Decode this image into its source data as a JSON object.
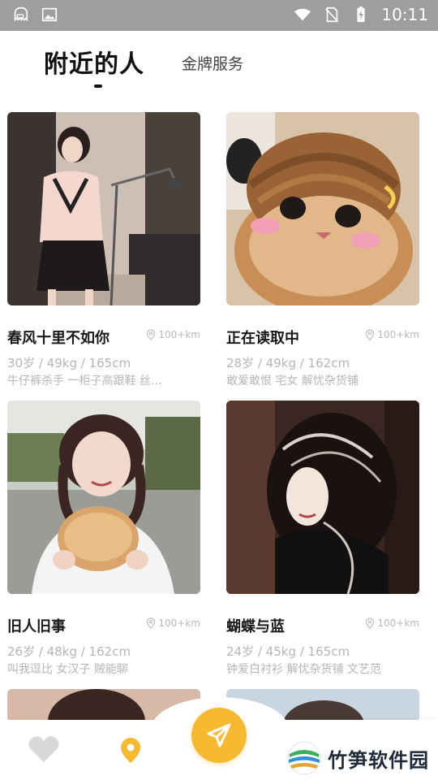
{
  "statusbar": {
    "time": "10:11"
  },
  "tabs": {
    "active": "附近的人",
    "other": "金牌服务"
  },
  "colors": {
    "accent": "#f7b92f",
    "muted_text": "#b5b5b5",
    "status_bar": "#9e9e9e"
  },
  "cards": [
    {
      "name": "春风十里不如你",
      "distance": "100+km",
      "stats": "30岁 / 49kg / 165cm",
      "tags": "牛仔裤杀手 一柜子高跟鞋 丝…"
    },
    {
      "name": "正在读取中",
      "distance": "100+km",
      "stats": "28岁 / 49kg / 162cm",
      "tags": "敢爱敢恨 宅女 解忧杂货铺"
    },
    {
      "name": "旧人旧事",
      "distance": "100+km",
      "stats": "26岁 / 48kg / 162cm",
      "tags": "叫我逗比 女汉子 贼能聊"
    },
    {
      "name": "蝴蝶与蓝",
      "distance": "100+km",
      "stats": "24岁 / 45kg / 165cm",
      "tags": "钟爱白衬衫 解忧杂货铺 文艺范"
    }
  ],
  "bottomnav": {
    "items": [
      "heart-icon",
      "location-pin-icon",
      "paper-plane-icon"
    ]
  },
  "watermark": {
    "text": "竹笋软件园"
  }
}
